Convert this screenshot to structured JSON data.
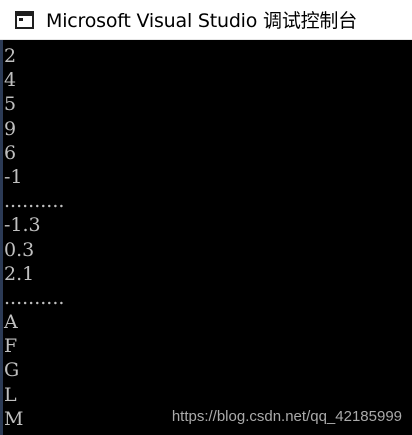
{
  "window": {
    "title": "Microsoft Visual Studio 调试控制台",
    "icon": "console-window-icon"
  },
  "console": {
    "lines": [
      "2",
      "4",
      "5",
      "9",
      "6",
      "-1",
      "..........",
      "-1.3",
      "0.3",
      "2.1",
      "..........",
      "A",
      "F",
      "G",
      "L",
      "M"
    ],
    "text_color": "#c0c0c0",
    "background": "#000000"
  },
  "watermark": {
    "text": "https://blog.csdn.net/qq_42185999"
  }
}
